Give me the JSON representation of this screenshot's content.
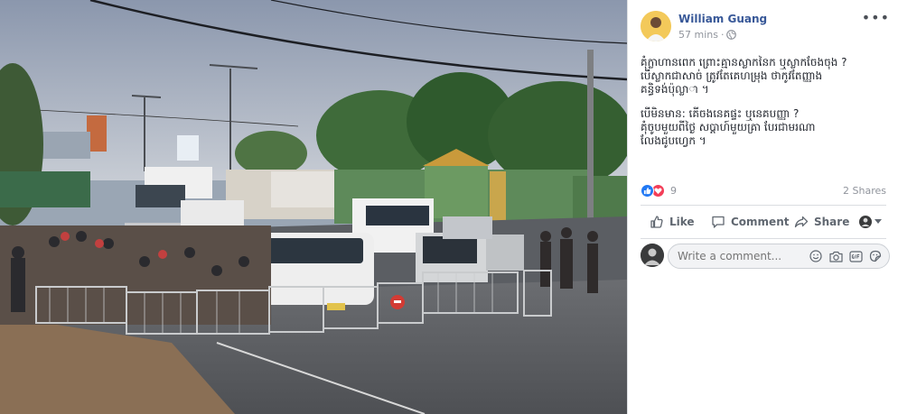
{
  "post": {
    "author": "William Guang",
    "time": "57 mins",
    "time_separator": "·",
    "privacy_icon": "globe-icon",
    "more_label": "•••",
    "text_paragraph_1": "គុំក្លាហានពេក ព្រោះគ្មានស្លាកនៃក ឬស្លាកចែងចុង ?\nបើស្លាកជាសាច់ ត្រូវតែគេហម្រុង ថាកូវតែញ្ញាង\nគន្ធិទង់ប៉ុល្លាា ។",
    "text_paragraph_2": "បើមិនមាន: គើចងនេគផ្ទះ ឬនេគបញ្ញា ?\nគុំចូបមួយពីថ្ងៃ សប្ដាហ៍មួយគ្រា បែរជាមរណា\nលែងជូបហ្វេក ។"
  },
  "reactions": {
    "count": "9",
    "shares": "2 Shares",
    "types": [
      "like",
      "love"
    ]
  },
  "actions": {
    "like": "Like",
    "comment": "Comment",
    "share": "Share"
  },
  "comment_box": {
    "placeholder": "Write a comment..."
  },
  "colors": {
    "link_blue": "#385898",
    "like_blue": "#2078f4",
    "love_red": "#f33e58",
    "meta_gray": "#90949c"
  }
}
